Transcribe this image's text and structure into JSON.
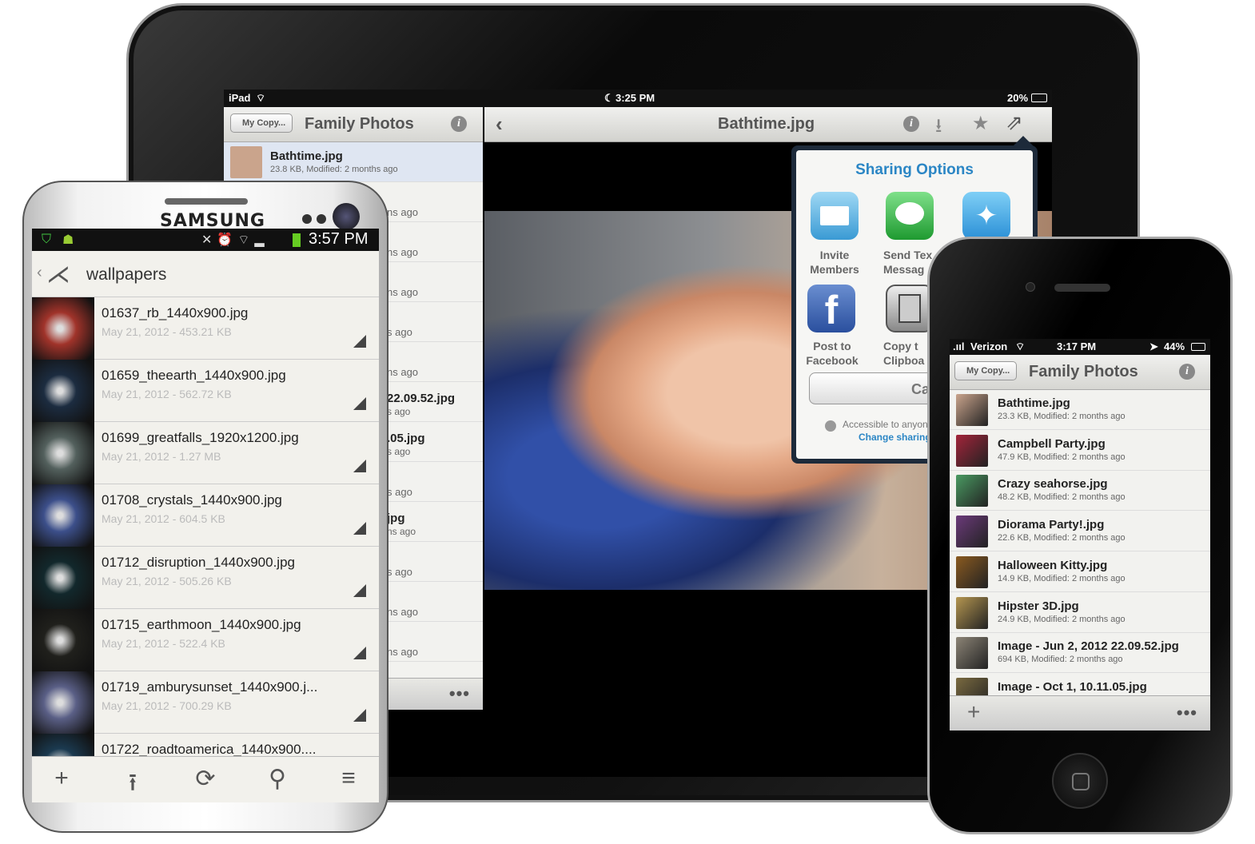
{
  "ipad": {
    "status": {
      "carrier": "iPad",
      "time": "3:25 PM",
      "battery": "20%"
    },
    "list_nav": {
      "back": "My Copy...",
      "title": "Family Photos"
    },
    "selected_file": {
      "name": "Bathtime.jpg",
      "meta": "23.8 KB, Modified: 2 months ago"
    },
    "partial_rows": [
      "ns ago",
      "ns ago",
      "ns ago",
      "s ago",
      "ns ago",
      "22.09.52.jpg",
      "s ago",
      ".05.jpg",
      "s ago",
      "s ago",
      "jpg",
      "ns ago",
      "s ago",
      "ns ago",
      "ns ago"
    ],
    "viewer_title": "Bathtime.jpg",
    "sharing": {
      "title": "Sharing Options",
      "options": [
        {
          "label1": "Invite",
          "label2": "Members",
          "icon": "mail-icon"
        },
        {
          "label1": "Send Tex",
          "label2": "Messag",
          "icon": "message-icon"
        },
        {
          "label1": "",
          "label2": "",
          "icon": "twitter-icon"
        },
        {
          "label1": "Post to",
          "label2": "Facebook",
          "icon": "facebook-icon"
        },
        {
          "label1": "Copy t",
          "label2": "Clipboa",
          "icon": "clipboard-icon"
        }
      ],
      "cancel": "Canc",
      "access_text": "Accessible to anyon",
      "change_link": "Change sharing"
    },
    "footer_more": "•••"
  },
  "samsung": {
    "brand": "SAMSUNG",
    "time": "3:57 PM",
    "folder": "wallpapers",
    "files": [
      {
        "name": "01637_rb_1440x900.jpg",
        "meta": "May 21, 2012 - 453.21 KB",
        "thumb": "#a0332a"
      },
      {
        "name": "01659_theearth_1440x900.jpg",
        "meta": "May 21, 2012 - 562.72 KB",
        "thumb": "#1c2c40"
      },
      {
        "name": "01699_greatfalls_1920x1200.jpg",
        "meta": "May 21, 2012 - 1.27 MB",
        "thumb": "#53605d"
      },
      {
        "name": "01708_crystals_1440x900.jpg",
        "meta": "May 21, 2012 - 604.5 KB",
        "thumb": "#3c4f8a"
      },
      {
        "name": "01712_disruption_1440x900.jpg",
        "meta": "May 21, 2012 - 505.26 KB",
        "thumb": "#12282c"
      },
      {
        "name": "01715_earthmoon_1440x900.jpg",
        "meta": "May 21, 2012 - 522.4 KB",
        "thumb": "#20201c"
      },
      {
        "name": "01719_amburysunset_1440x900.j...",
        "meta": "May 21, 2012 - 700.29 KB",
        "thumb": "#5a5f86"
      },
      {
        "name": "01722_roadtoamerica_1440x900....",
        "meta": "",
        "thumb": "#1b3a50"
      }
    ],
    "toolbar": {
      "add": "+",
      "upload": "⭱",
      "sync": "⟳",
      "search": "⚲",
      "menu": "≡"
    }
  },
  "iphone": {
    "status": {
      "carrier": "Verizon",
      "time": "3:17 PM",
      "battery": "44%"
    },
    "nav": {
      "back": "My Copy...",
      "title": "Family Photos"
    },
    "files": [
      {
        "name": "Bathtime.jpg",
        "meta": "23.3 KB, Modified: 2 months ago",
        "thumb": "#caa48c"
      },
      {
        "name": "Campbell Party.jpg",
        "meta": "47.9 KB, Modified: 2 months ago",
        "thumb": "#a3243a"
      },
      {
        "name": "Crazy seahorse.jpg",
        "meta": "48.2 KB, Modified: 2 months ago",
        "thumb": "#4a9a62"
      },
      {
        "name": "Diorama Party!.jpg",
        "meta": "22.6 KB, Modified: 2 months ago",
        "thumb": "#6b3a7a"
      },
      {
        "name": "Halloween Kitty.jpg",
        "meta": "14.9 KB, Modified: 2 months ago",
        "thumb": "#8a5a20"
      },
      {
        "name": "Hipster 3D.jpg",
        "meta": "24.9 KB, Modified: 2 months ago",
        "thumb": "#b59650"
      },
      {
        "name": "Image - Jun 2, 2012 22.09.52.jpg",
        "meta": "694 KB, Modified: 2 months ago",
        "thumb": "#8c8476"
      },
      {
        "name": "Image - Oct 1, 10.11.05.jpg",
        "meta": "",
        "thumb": "#7a6a40"
      }
    ],
    "footer_add": "+",
    "footer_more": "•••"
  }
}
